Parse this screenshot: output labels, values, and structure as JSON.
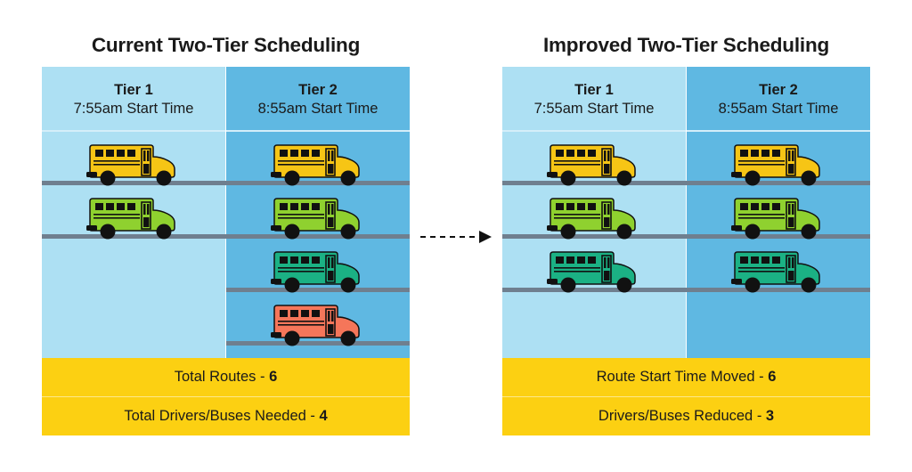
{
  "colors": {
    "tier1_bg": "#ade0f3",
    "tier2_bg": "#5fb8e2",
    "summary_bg": "#fcd012",
    "road": "#6f7f8f",
    "bus_yellow": "#f6c515",
    "bus_lime": "#8fd12f",
    "bus_teal": "#1bb184",
    "bus_coral": "#f5765a"
  },
  "current": {
    "title": "Current Two-Tier Scheduling",
    "tiers": [
      {
        "name": "Tier 1",
        "start": "7:55am Start Time",
        "buses": [
          "yellow",
          "lime"
        ]
      },
      {
        "name": "Tier 2",
        "start": "8:55am Start Time",
        "buses": [
          "yellow",
          "lime",
          "teal",
          "coral"
        ]
      }
    ],
    "summary": [
      {
        "label": "Total Routes - ",
        "value": "6"
      },
      {
        "label": "Total Drivers/Buses Needed - ",
        "value": "4"
      }
    ]
  },
  "improved": {
    "title": "Improved Two-Tier Scheduling",
    "tiers": [
      {
        "name": "Tier 1",
        "start": "7:55am Start Time",
        "buses": [
          "yellow",
          "lime",
          "teal"
        ]
      },
      {
        "name": "Tier 2",
        "start": "8:55am Start Time",
        "buses": [
          "yellow",
          "lime",
          "teal"
        ]
      }
    ],
    "summary": [
      {
        "label": "Route Start Time Moved - ",
        "value": "6"
      },
      {
        "label": "Drivers/Buses Reduced - ",
        "value": "3"
      }
    ]
  },
  "arrow_icon": "dashed-right-arrow"
}
